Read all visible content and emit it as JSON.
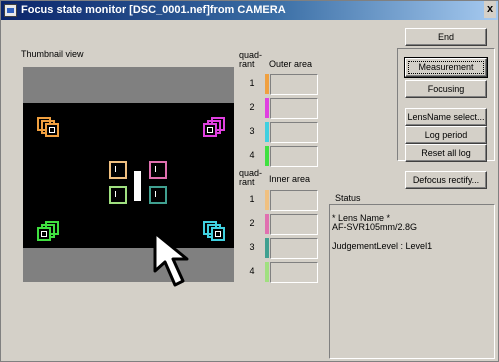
{
  "window": {
    "title": "Focus state monitor  [DSC_0001.nef]from CAMERA",
    "close_label": "x"
  },
  "thumbnail": {
    "label": "Thumbnail view"
  },
  "outer": {
    "header": "quad-\nrant",
    "area_label": "Outer area",
    "quadrants": [
      {
        "num": "1",
        "color": "#f0a040"
      },
      {
        "num": "2",
        "color": "#e040e0"
      },
      {
        "num": "3",
        "color": "#40d0e0"
      },
      {
        "num": "4",
        "color": "#40e040"
      }
    ]
  },
  "inner": {
    "header": "quad-\nrant",
    "area_label": "Inner area",
    "quadrants": [
      {
        "num": "1",
        "color": "#f0c080"
      },
      {
        "num": "2",
        "color": "#e070b0"
      },
      {
        "num": "3",
        "color": "#40a090"
      },
      {
        "num": "4",
        "color": "#a0e080"
      }
    ]
  },
  "buttons": {
    "end": "End",
    "measurement": "Measurement",
    "focusing": "Focusing",
    "lensname": "LensName select...",
    "log_period": "Log period",
    "reset_log": "Reset all log",
    "defocus": "Defocus rectify..."
  },
  "status": {
    "label": "Status",
    "lens_title": "* Lens Name *",
    "lens_value": "AF-SVR105mm/2.8G",
    "judgement": "JudgementLevel : Level1"
  },
  "colors": {
    "orange": "#f0a040",
    "magenta": "#e040e0",
    "cyan": "#40d0e0",
    "green": "#40e040",
    "teal": "#40a090",
    "title_bar": "#0a246a"
  }
}
